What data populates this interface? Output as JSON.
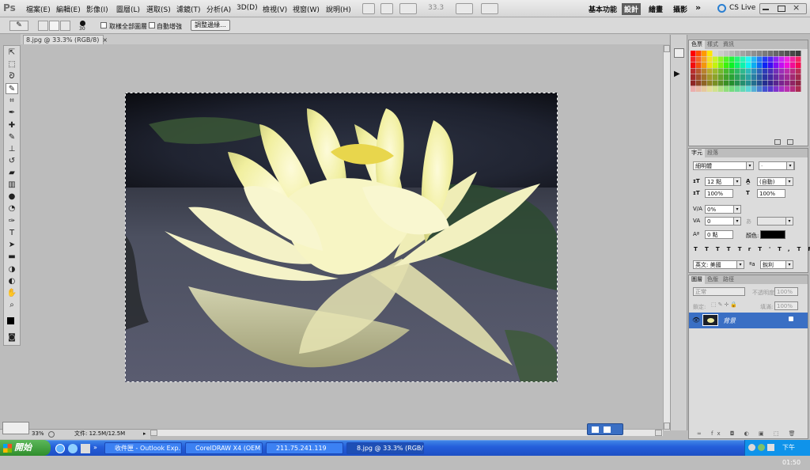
{
  "menubar": {
    "logo": "Ps",
    "menus": [
      "檔案(E)",
      "編輯(E)",
      "影像(I)",
      "圖層(L)",
      "選取(S)",
      "濾鏡(T)",
      "分析(A)",
      "3D(D)",
      "檢視(V)",
      "視窗(W)",
      "說明(H)"
    ],
    "zoom": "33.3",
    "workspaces": [
      "基本功能",
      "設計",
      "繪畫",
      "攝影"
    ],
    "more": "»",
    "cslive": "CS Live"
  },
  "options": {
    "brush_size": "30",
    "sample_all": "取樣全部圖層",
    "auto_enhance": "自動增強",
    "refine_edge": "調整邊緣..."
  },
  "document": {
    "tab": "8.jpg @ 33.3% (RGB/8)"
  },
  "status": {
    "zoom": "33%",
    "doc": "文件: 12.5M/12.5M"
  },
  "swatches": {
    "tabs": [
      "色票",
      "樣式",
      "資訊"
    ]
  },
  "character": {
    "tabs": [
      "字元",
      "段落"
    ],
    "font": "細明體",
    "font_style": "-",
    "size": "12 點",
    "leading": "(自動)",
    "vscale": "100%",
    "hscale": "100%",
    "tracking_kern": "0%",
    "tracking": "0",
    "baseline": "0 點",
    "color_label": "顏色:",
    "language": "英文: 美國",
    "aa": "銳利",
    "tt": [
      "T",
      "T",
      "TT",
      "Tr",
      "T'",
      "T,",
      "T",
      "F"
    ]
  },
  "layers": {
    "tabs": [
      "圖層",
      "色版",
      "路徑"
    ],
    "mode": "正常",
    "opacity_label": "不透明度:",
    "opacity": "100%",
    "lock_label": "鎖定:",
    "fill_label": "填滿:",
    "fill": "100%",
    "layer_name": "背景"
  },
  "taskbar": {
    "start": "開始",
    "tasks": [
      "收件匣 - Outlook Exp...",
      "CorelDRAW X4 (OEM ...",
      "211.75.241.119",
      "8.jpg @ 33.3% (RGB/8)"
    ],
    "clock": "下午 01:50"
  },
  "colors": {
    "accent": "#3a6fc4",
    "selection": "#2b58a8"
  }
}
